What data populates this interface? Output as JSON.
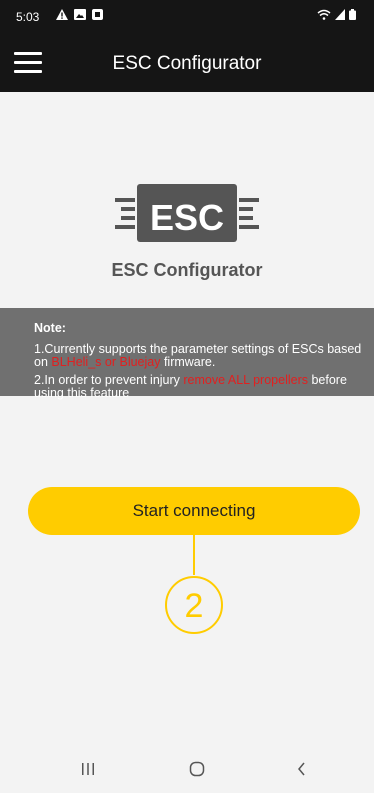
{
  "status_bar": {
    "time": "5:03",
    "left_icons": [
      "warning-icon",
      "image-icon",
      "notification-icon"
    ],
    "right_icons": [
      "wifi-icon",
      "signal-icon",
      "battery-icon"
    ]
  },
  "app_bar": {
    "title": "ESC Configurator",
    "menu_icon": "hamburger-menu-icon"
  },
  "logo": {
    "mark_text": "ESC",
    "caption": "ESC Configurator"
  },
  "note": {
    "title": "Note:",
    "item1_prefix": "1.Currently supports the parameter settings of ESCs based on ",
    "item1_highlight": "BLHeli_s or Bluejay",
    "item1_suffix": " firmware.",
    "item2_prefix": "2.In order to prevent injury ",
    "item2_highlight": "remove ALL propellers",
    "item2_suffix": " before using this feature",
    "highlight_color": "#e12020"
  },
  "actions": {
    "start_label": "Start connecting"
  },
  "annotation": {
    "number": "2",
    "color": "#ffcc00"
  },
  "nav_bar": {
    "recents_icon": "recents-icon",
    "home_icon": "home-icon",
    "back_icon": "back-icon"
  },
  "colors": {
    "accent": "#ffcc00",
    "bar_bg": "#151515",
    "note_bg": "#707070"
  }
}
